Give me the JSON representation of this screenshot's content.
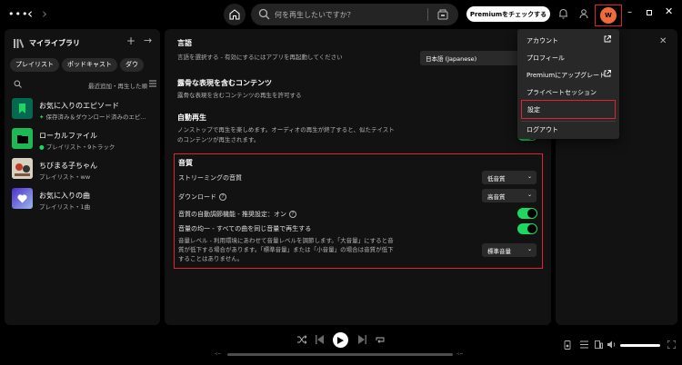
{
  "topbar": {
    "search_placeholder": "何を再生したいですか？",
    "premium_label": "Premiumをチェックする",
    "avatar_initial": "W"
  },
  "library": {
    "title": "マイライブラリ",
    "chips": [
      "プレイリスト",
      "ポッドキャスト",
      "ダウ"
    ],
    "sort_label": "最近追加・再生した順",
    "items": [
      {
        "name": "お気に入りのエピソード",
        "sub": "保存済み＆ダウンロード済みのエピ...",
        "thumb_color": "#056952"
      },
      {
        "name": "ローカルファイル",
        "sub": "プレイリスト・9トラック",
        "thumb_color": "#1db954"
      },
      {
        "name": "ちびまる子ちゃん",
        "sub": "プレイリスト・ww",
        "thumb_color": "#d8d0c0"
      },
      {
        "name": "お気に入りの曲",
        "sub": "プレイリスト・1曲",
        "thumb_color": "#7a5cf0"
      }
    ]
  },
  "settings": {
    "language": {
      "title": "言語",
      "desc": "言語を選択する - 有効にするにはアプリを再起動してください",
      "value": "日本語 (Japanese)"
    },
    "explicit": {
      "title": "露骨な表現を含むコンテンツ",
      "desc": "露骨な表現を含むコンテンツの再生を許可する"
    },
    "autoplay": {
      "title": "自動再生",
      "desc1": "ノンストップで再生を楽しめます。オーディオの再生が終了すると、似たテイスト",
      "desc2": "のコンテンツが再生されます。"
    },
    "quality": {
      "title": "音質",
      "streaming_label": "ストリーミングの音質",
      "streaming_value": "低音質",
      "download_label": "ダウンロード",
      "download_value": "高音質",
      "auto_adjust_label": "音質の自動調節機能 - 推奨設定：オン",
      "normalize_label": "音量の均一 - すべての曲を同じ音量で再生する",
      "level_desc1": "音量レベル - 利用環境にあわせて音量レベルを調節します。「大音量」にすると音",
      "level_desc2": "質が低下する場合があります。「標準音量」または「小音量」の場合は音質が低下",
      "level_desc3": "することはありません。",
      "level_value": "標準音量"
    }
  },
  "menu": {
    "items": [
      "アカウント",
      "プロフィール",
      "Premiumにアップグレード",
      "プライベートセッション",
      "設定",
      "ログアウト"
    ]
  },
  "player": {
    "time_elapsed": "-:--",
    "time_total": "-:--"
  }
}
